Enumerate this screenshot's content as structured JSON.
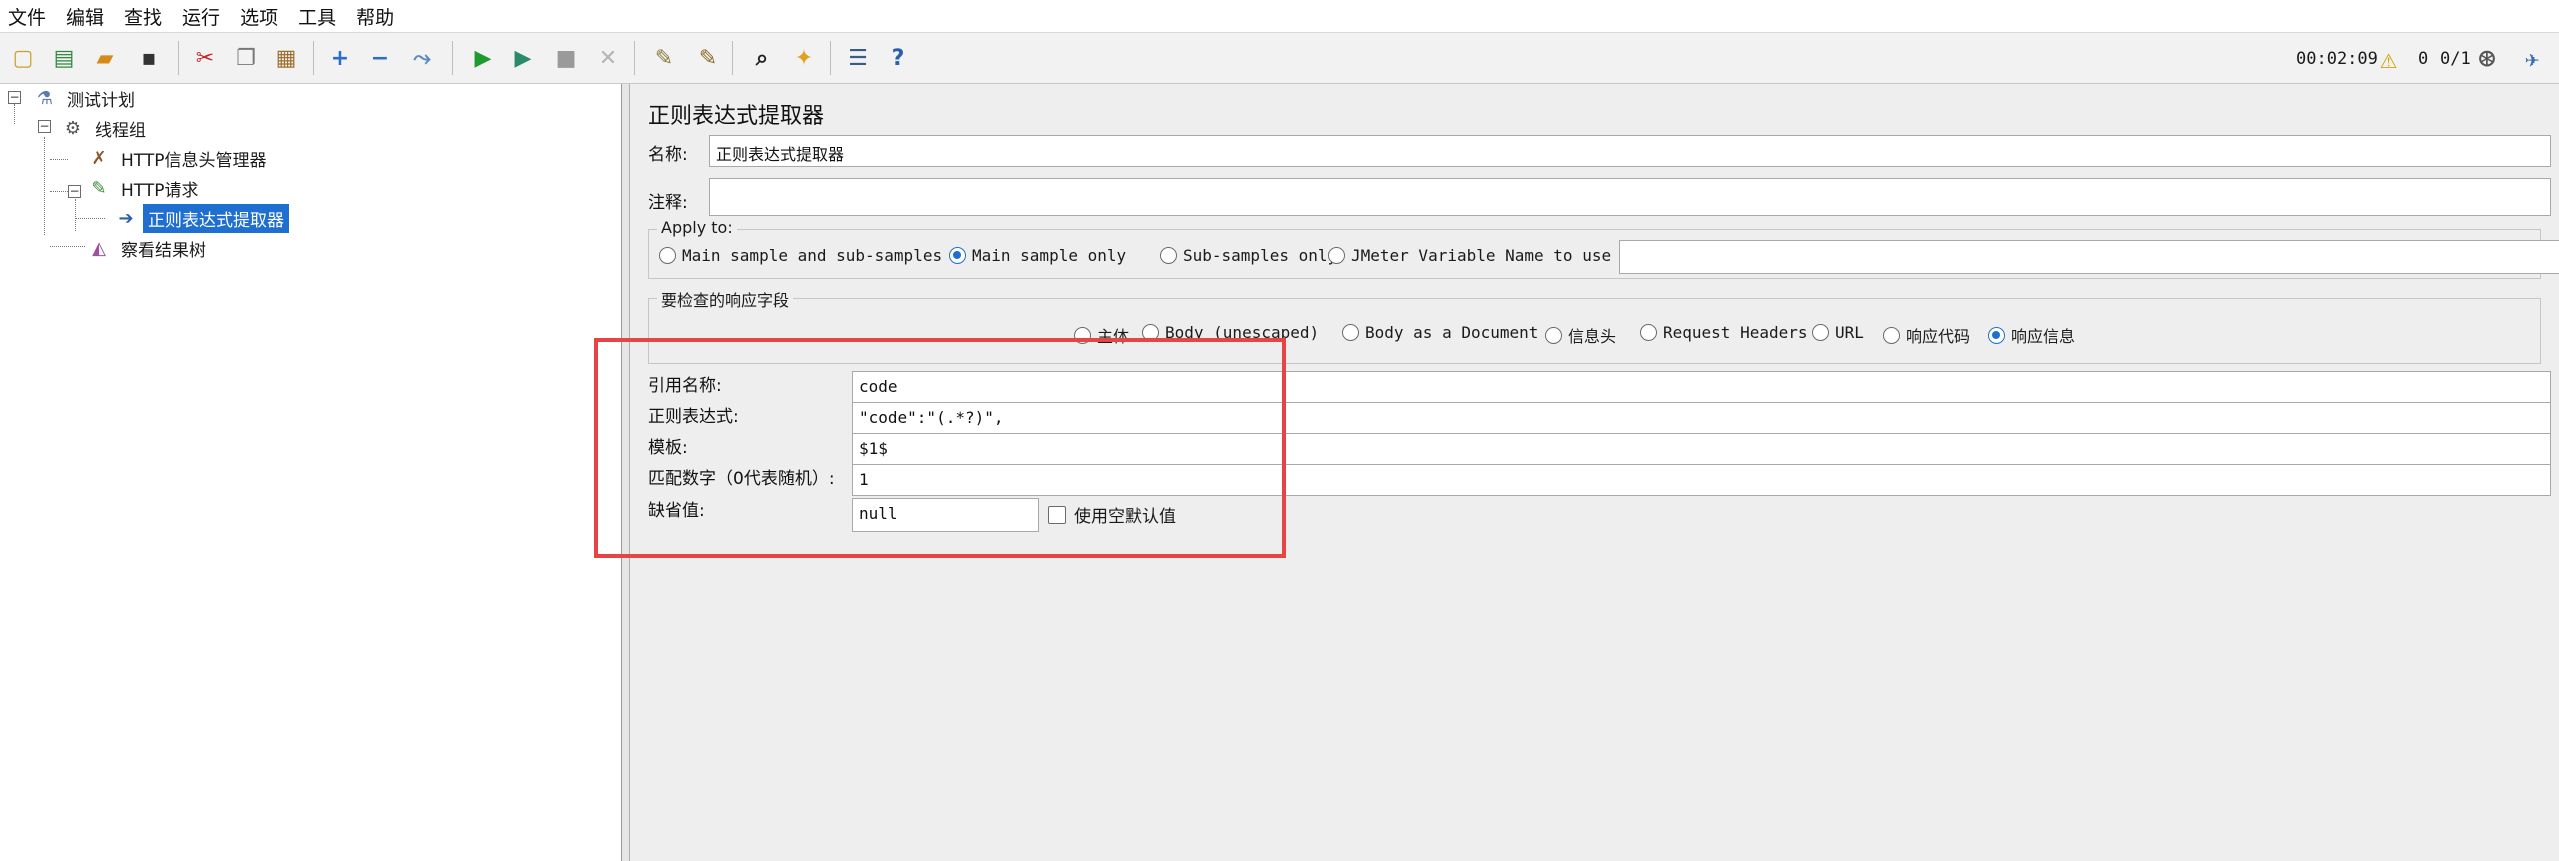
{
  "menu": [
    "文件",
    "编辑",
    "查找",
    "运行",
    "选项",
    "工具",
    "帮助"
  ],
  "toolbar": {
    "icons": [
      {
        "name": "new-icon",
        "glyph": "▢",
        "color": "#c9a227"
      },
      {
        "name": "templates-icon",
        "glyph": "▤",
        "color": "#2f8a3c"
      },
      {
        "name": "open-icon",
        "glyph": "▰",
        "color": "#d58a1c"
      },
      {
        "name": "save-icon",
        "glyph": "▪",
        "color": "#333333"
      },
      {
        "name": "cut-icon",
        "glyph": "✂",
        "color": "#cc2222"
      },
      {
        "name": "copy-icon",
        "glyph": "❐",
        "color": "#777777"
      },
      {
        "name": "paste-icon",
        "glyph": "▦",
        "color": "#a07030"
      },
      {
        "name": "expand-icon",
        "glyph": "+",
        "color": "#2a6fc9"
      },
      {
        "name": "collapse-icon",
        "glyph": "−",
        "color": "#2a6fc9"
      },
      {
        "name": "toggle-icon",
        "glyph": "⤳",
        "color": "#5a8ac0"
      },
      {
        "name": "start-icon",
        "glyph": "▶",
        "color": "#1e9a2e"
      },
      {
        "name": "start-no-pauses-icon",
        "glyph": "▶",
        "color": "#2a8a6a"
      },
      {
        "name": "stop-icon",
        "glyph": "■",
        "color": "#9a9a9a"
      },
      {
        "name": "shutdown-icon",
        "glyph": "✕",
        "color": "#b5b5b5"
      },
      {
        "name": "clear-icon",
        "glyph": "✎",
        "color": "#8a7a3a"
      },
      {
        "name": "clear-all-icon",
        "glyph": "✎",
        "color": "#8a6a2a"
      },
      {
        "name": "search-icon",
        "glyph": "⌕",
        "color": "#222222"
      },
      {
        "name": "reset-search-icon",
        "glyph": "✦",
        "color": "#e0a020"
      },
      {
        "name": "function-helper-icon",
        "glyph": "☰",
        "color": "#3a5a8a"
      },
      {
        "name": "help-icon",
        "glyph": "?",
        "color": "#2a5fb0"
      }
    ],
    "timer": "00:02:09",
    "warning_count": "0",
    "threads": "0/1"
  },
  "tree": {
    "nodes": [
      {
        "label": "测试计划",
        "icon": "test-plan-icon"
      },
      {
        "label": "线程组",
        "icon": "thread-group-icon"
      },
      {
        "label": "HTTP信息头管理器",
        "icon": "header-manager-icon"
      },
      {
        "label": "HTTP请求",
        "icon": "http-request-icon"
      },
      {
        "label": "正则表达式提取器",
        "icon": "regex-extractor-icon"
      },
      {
        "label": "察看结果树",
        "icon": "results-tree-icon"
      }
    ]
  },
  "panel": {
    "title": "正则表达式提取器",
    "name_label": "名称:",
    "name_value": "正则表达式提取器",
    "comment_label": "注释:",
    "comment_value": "",
    "apply_to": {
      "legend": "Apply to:",
      "options": [
        "Main sample and sub-samples",
        "Main sample only",
        "Sub-samples only",
        "JMeter Variable Name to use"
      ],
      "selected": "Main sample only",
      "variable_value": ""
    },
    "field_to_check": {
      "legend": "要检查的响应字段",
      "options": [
        "主体",
        "Body (unescaped)",
        "Body as a Document",
        "信息头",
        "Request Headers",
        "URL",
        "响应代码",
        "响应信息"
      ],
      "selected": "响应信息"
    },
    "ref_name_label": "引用名称:",
    "ref_name_value": "code",
    "regex_label": "正则表达式:",
    "regex_value": "\"code\":\"(.*?)\",",
    "template_label": "模板:",
    "template_value": "$1$",
    "match_no_label": "匹配数字（0代表随机）:",
    "match_no_value": "1",
    "default_label": "缺省值:",
    "default_value": "null",
    "empty_default_label": "使用空默认值"
  },
  "accent": "#1f6fd1",
  "highlight_color": "#e64545"
}
